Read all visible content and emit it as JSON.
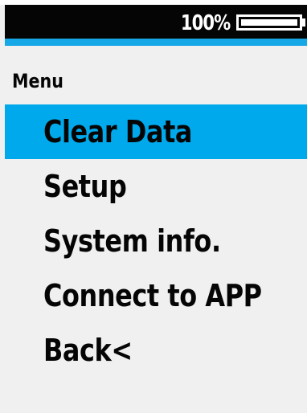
{
  "status": {
    "battery_percent": "100%",
    "battery_level": 1.0
  },
  "menu": {
    "title": "Menu",
    "items": [
      {
        "label": "Clear Data",
        "selected": true
      },
      {
        "label": "Setup",
        "selected": false
      },
      {
        "label": "System info.",
        "selected": false
      },
      {
        "label": "Connect to APP",
        "selected": false
      },
      {
        "label": "Back<",
        "selected": false
      }
    ]
  },
  "colors": {
    "status_bar": "#050505",
    "accent": "#15a7e6",
    "highlight": "#00a9eb",
    "background": "#f0f0f0"
  }
}
